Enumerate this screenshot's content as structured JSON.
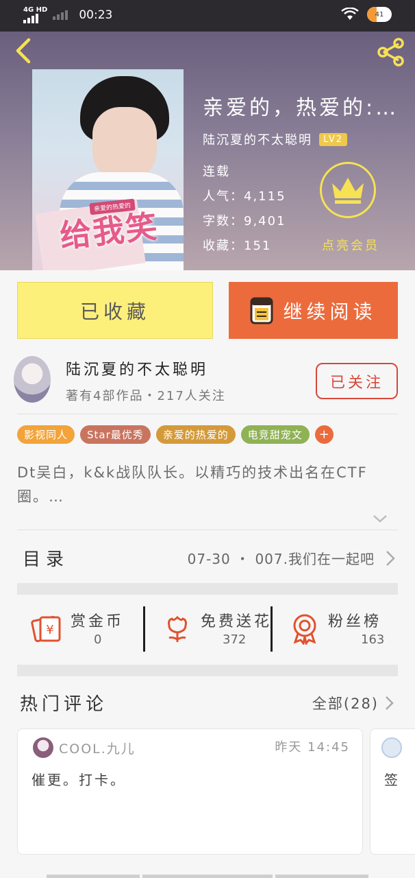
{
  "status_bar": {
    "network": "4G HD",
    "time": "00:23",
    "battery": "41"
  },
  "book": {
    "title": "亲爱的，热爱的:…",
    "cover_title": "给我笑",
    "cover_badge": "亲爱的热爱的",
    "author": "陆沉夏的不太聪明",
    "author_level": "LV2",
    "status": "连载",
    "popularity": "人气：4,115",
    "word_count": "字数：9,401",
    "favorites": "收藏：151"
  },
  "vip": {
    "label": "点亮会员"
  },
  "actions": {
    "collected_label": "已收藏",
    "read_label": "继续阅读"
  },
  "author_card": {
    "name": "陆沉夏的不太聪明",
    "subtitle": "著有4部作品・217人关注",
    "follow_label": "已关注"
  },
  "tags": [
    {
      "label": "影视同人",
      "color": "#f2a33a"
    },
    {
      "label": "Star最优秀",
      "color": "#c9745f"
    },
    {
      "label": "亲爱的热爱的",
      "color": "#d49a3a"
    },
    {
      "label": "电竞甜宠文",
      "color": "#8fb255"
    }
  ],
  "tag_add": "+",
  "synopsis": "Dt吴白，k&k战队队长。以精巧的技术出名在CTF圈。…",
  "toc": {
    "label": "目录",
    "latest": "07-30 ・ 007.我们在一起吧"
  },
  "stats": [
    {
      "label": "赏金币",
      "value": "0",
      "icon": "money-icon",
      "color": "#e0522f"
    },
    {
      "label": "免费送花",
      "value": "372",
      "icon": "flower-icon",
      "color": "#e0522f"
    },
    {
      "label": "粉丝榜",
      "value": "163",
      "icon": "medal-icon",
      "color": "#e0522f"
    }
  ],
  "comments": {
    "title": "热门评论",
    "all_label": "全部(28)",
    "items": [
      {
        "user": "COOL.九儿",
        "time": "昨天 14:45",
        "text": "催更。打卡。"
      },
      {
        "user": "",
        "time": "",
        "text": "签"
      }
    ]
  },
  "colors": {
    "accent": "#ec6b3d",
    "collected_bg": "#fdf07a",
    "follow_red": "#d9463b",
    "vip_yellow": "#f7e253"
  }
}
